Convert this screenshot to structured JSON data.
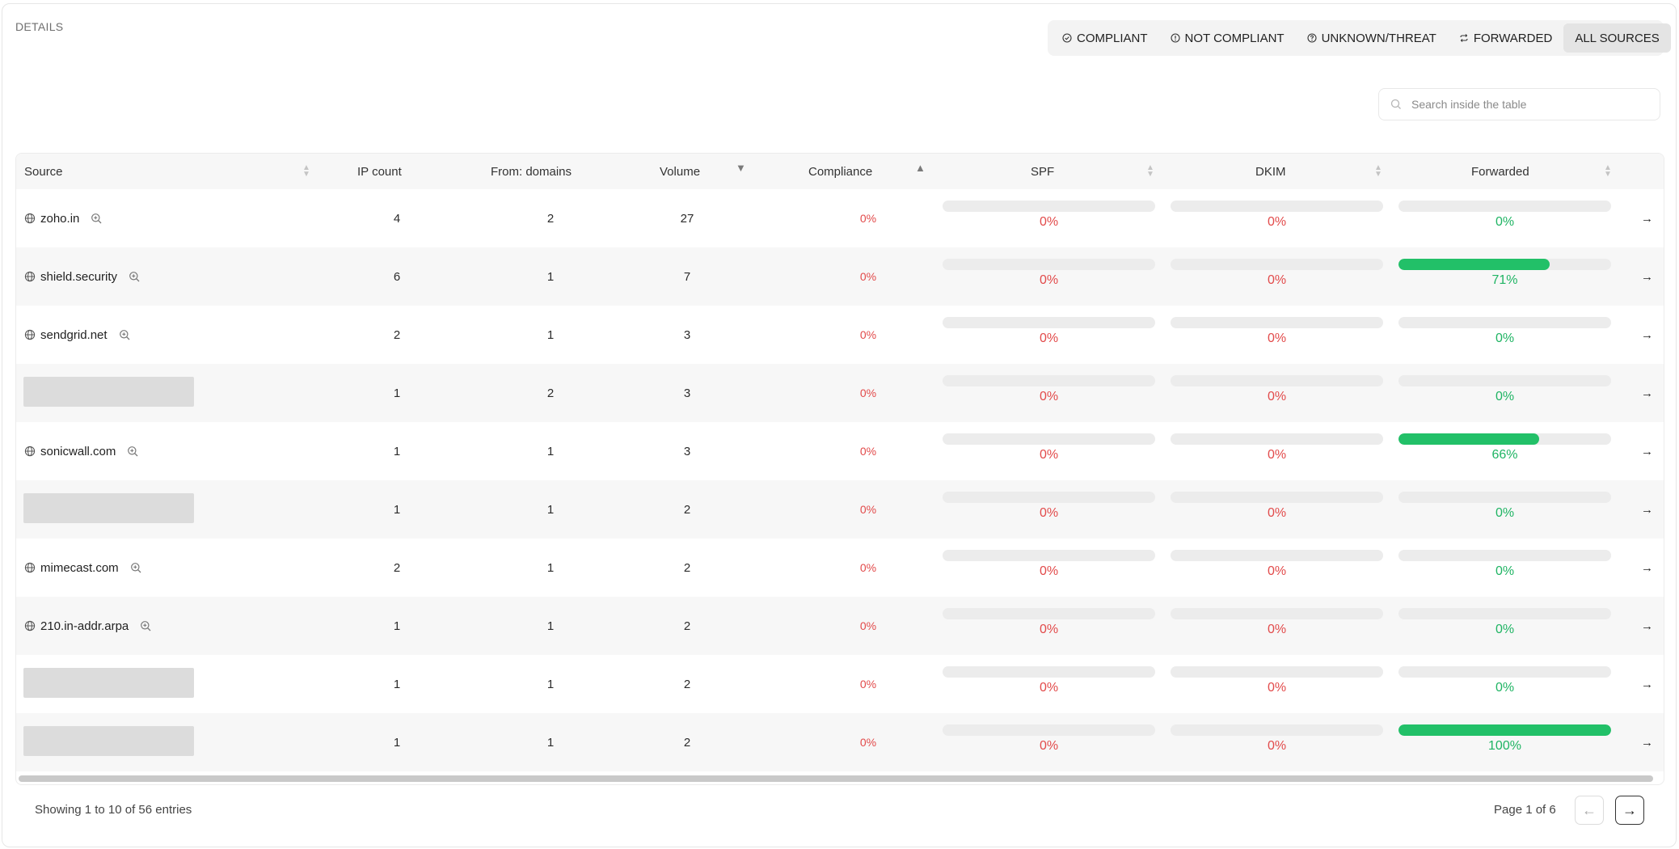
{
  "header": {
    "title": "DETAILS"
  },
  "filters": [
    {
      "label": "COMPLIANT",
      "icon": "check-circle-icon",
      "active": false
    },
    {
      "label": "NOT COMPLIANT",
      "icon": "info-circle-icon",
      "active": false
    },
    {
      "label": "UNKNOWN/THREAT",
      "icon": "question-circle-icon",
      "active": false
    },
    {
      "label": "FORWARDED",
      "icon": "forward-arrows-icon",
      "active": false
    },
    {
      "label": "ALL SOURCES",
      "icon": "",
      "active": true
    }
  ],
  "search": {
    "placeholder": "Search inside the table",
    "value": ""
  },
  "table": {
    "columns": {
      "source": "Source",
      "ip_count": "IP count",
      "from_domains": "From: domains",
      "volume": "Volume",
      "compliance": "Compliance",
      "spf": "SPF",
      "dkim": "DKIM",
      "forwarded": "Forwarded"
    },
    "rows": [
      {
        "source": "zoho.in",
        "redacted": false,
        "ip_count": "4",
        "from_domains": "2",
        "volume": "27",
        "compliance": "0%",
        "spf": "0%",
        "dkim": "0%",
        "forwarded": "0%",
        "forwarded_pct": 0
      },
      {
        "source": "shield.security",
        "redacted": false,
        "ip_count": "6",
        "from_domains": "1",
        "volume": "7",
        "compliance": "0%",
        "spf": "0%",
        "dkim": "0%",
        "forwarded": "71%",
        "forwarded_pct": 71
      },
      {
        "source": "sendgrid.net",
        "redacted": false,
        "ip_count": "2",
        "from_domains": "1",
        "volume": "3",
        "compliance": "0%",
        "spf": "0%",
        "dkim": "0%",
        "forwarded": "0%",
        "forwarded_pct": 0
      },
      {
        "source": "",
        "redacted": true,
        "ip_count": "1",
        "from_domains": "2",
        "volume": "3",
        "compliance": "0%",
        "spf": "0%",
        "dkim": "0%",
        "forwarded": "0%",
        "forwarded_pct": 0
      },
      {
        "source": "sonicwall.com",
        "redacted": false,
        "ip_count": "1",
        "from_domains": "1",
        "volume": "3",
        "compliance": "0%",
        "spf": "0%",
        "dkim": "0%",
        "forwarded": "66%",
        "forwarded_pct": 66
      },
      {
        "source": "",
        "redacted": true,
        "ip_count": "1",
        "from_domains": "1",
        "volume": "2",
        "compliance": "0%",
        "spf": "0%",
        "dkim": "0%",
        "forwarded": "0%",
        "forwarded_pct": 0
      },
      {
        "source": "mimecast.com",
        "redacted": false,
        "ip_count": "2",
        "from_domains": "1",
        "volume": "2",
        "compliance": "0%",
        "spf": "0%",
        "dkim": "0%",
        "forwarded": "0%",
        "forwarded_pct": 0
      },
      {
        "source": "210.in-addr.arpa",
        "redacted": false,
        "ip_count": "1",
        "from_domains": "1",
        "volume": "2",
        "compliance": "0%",
        "spf": "0%",
        "dkim": "0%",
        "forwarded": "0%",
        "forwarded_pct": 0
      },
      {
        "source": "",
        "redacted": true,
        "ip_count": "1",
        "from_domains": "1",
        "volume": "2",
        "compliance": "0%",
        "spf": "0%",
        "dkim": "0%",
        "forwarded": "0%",
        "forwarded_pct": 0
      },
      {
        "source": "",
        "redacted": true,
        "ip_count": "1",
        "from_domains": "1",
        "volume": "2",
        "compliance": "0%",
        "spf": "0%",
        "dkim": "0%",
        "forwarded": "100%",
        "forwarded_pct": 100
      }
    ]
  },
  "footer": {
    "showing": "Showing 1 to 10 of 56 entries",
    "page": "Page 1 of 6"
  },
  "colors": {
    "red": "#e24a4a",
    "green": "#1fb463",
    "bar_fill": "#22c068",
    "track": "#ececec"
  }
}
